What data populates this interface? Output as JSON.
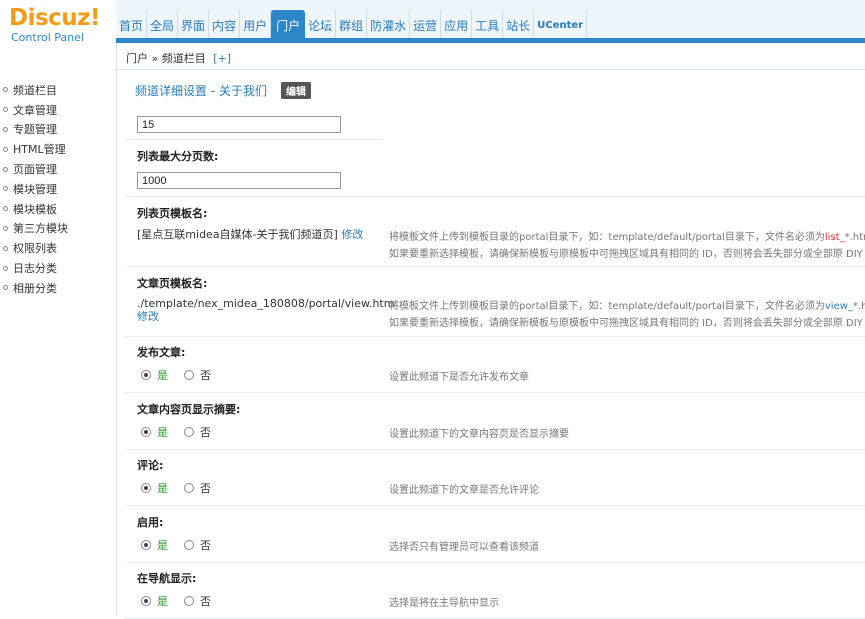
{
  "brand": {
    "name": "Discuz!",
    "subtitle": "Control Panel"
  },
  "topnav": [
    {
      "label": "首页"
    },
    {
      "label": "全局"
    },
    {
      "label": "界面"
    },
    {
      "label": "内容"
    },
    {
      "label": "用户"
    },
    {
      "label": "门户",
      "active": true
    },
    {
      "label": "论坛"
    },
    {
      "label": "群组"
    },
    {
      "label": "防灌水"
    },
    {
      "label": "运营"
    },
    {
      "label": "应用"
    },
    {
      "label": "工具"
    },
    {
      "label": "站长"
    },
    {
      "label": "UCenter"
    }
  ],
  "breadcrumb": {
    "text": "门户 » 频道栏目",
    "plus": "[+]"
  },
  "leftmenu": [
    "频道栏目",
    "文章管理",
    "专题管理",
    "HTML管理",
    "页面管理",
    "模块管理",
    "模块模板",
    "第三方模块",
    "权限列表",
    "日志分类",
    "相册分类"
  ],
  "page": {
    "title": "频道详细设置 - 关于我们",
    "edit_label": "编辑"
  },
  "fields": {
    "per_page_value": "15",
    "max_pages_label": "列表最大分页数:",
    "max_pages_value": "1000",
    "list_tpl_label": "列表页模板名:",
    "list_tpl_value": "[星点互联midea自媒体-关于我们频道页]",
    "list_tpl_link": "修改",
    "list_tpl_tip1_a": "将模板文件上传到模板目录的portal目录下，如：template/default/portal目录下，文件名必须为",
    "list_tpl_tip1_b": "list_",
    "list_tpl_tip1_c": "*.htm，",
    "list_tpl_tip2": "如果要重新选择模板，请确保新模板与原模板中可拖拽区域具有相同的 ID，否则将会丢失部分或全部原 DIY 数据",
    "view_tpl_label": "文章页模板名:",
    "view_tpl_value": "./template/nex_midea_180808/portal/view.htm",
    "view_tpl_link": "修改",
    "view_tpl_tip1_a": "将模板文件上传到模板目录的portal目录下，如：template/default/portal目录下，文件名必须为",
    "view_tpl_tip1_b": "view_",
    "view_tpl_tip1_c": "*.htm，",
    "view_tpl_tip2": "如果要重新选择模板，请确保新模板与原模板中可拖拽区域具有相同的 ID，否则将会丢失部分或全部原 DIY 数据"
  },
  "radios": [
    {
      "label": "发布文章:",
      "yes": "是",
      "no": "否",
      "selected": "yes",
      "tip": "设置此频道下是否允许发布文章"
    },
    {
      "label": "文章内容页显示摘要:",
      "yes": "是",
      "no": "否",
      "selected": "yes",
      "tip": "设置此频道下的文章内容页是否显示摘要"
    },
    {
      "label": "评论:",
      "yes": "是",
      "no": "否",
      "selected": "yes",
      "tip": "设置此频道下的文章是否允许评论"
    },
    {
      "label": "启用:",
      "yes": "是",
      "no": "否",
      "selected": "yes",
      "tip": "选择否只有管理员可以查看该频道"
    },
    {
      "label": "在导航显示:",
      "yes": "是",
      "no": "否",
      "selected": "yes",
      "tip": "选择是将在主导航中显示"
    }
  ],
  "colors": {
    "accent": "#2c86c8",
    "logo": "#f29c1a",
    "yes": "#2a9a2a",
    "highlight": "#e53030"
  }
}
